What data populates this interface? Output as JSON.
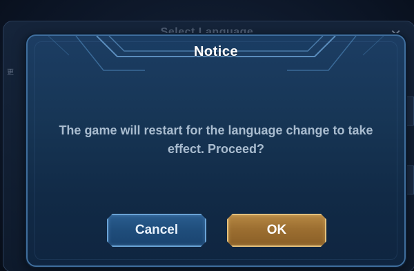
{
  "background": {
    "title": "Select Language",
    "close_symbol": "✕",
    "side_tag": "更"
  },
  "dialog": {
    "title": "Notice",
    "message": "The game will restart for the language change to take effect. Proceed?",
    "buttons": {
      "cancel_label": "Cancel",
      "ok_label": "OK"
    }
  },
  "colors": {
    "dialog_bg": "#173656",
    "dialog_border": "#3f6e9d",
    "cancel_button": "#1f4d7b",
    "ok_button": "#9c6f31",
    "message_text": "#a9bccf",
    "title_text": "#ffffff"
  }
}
